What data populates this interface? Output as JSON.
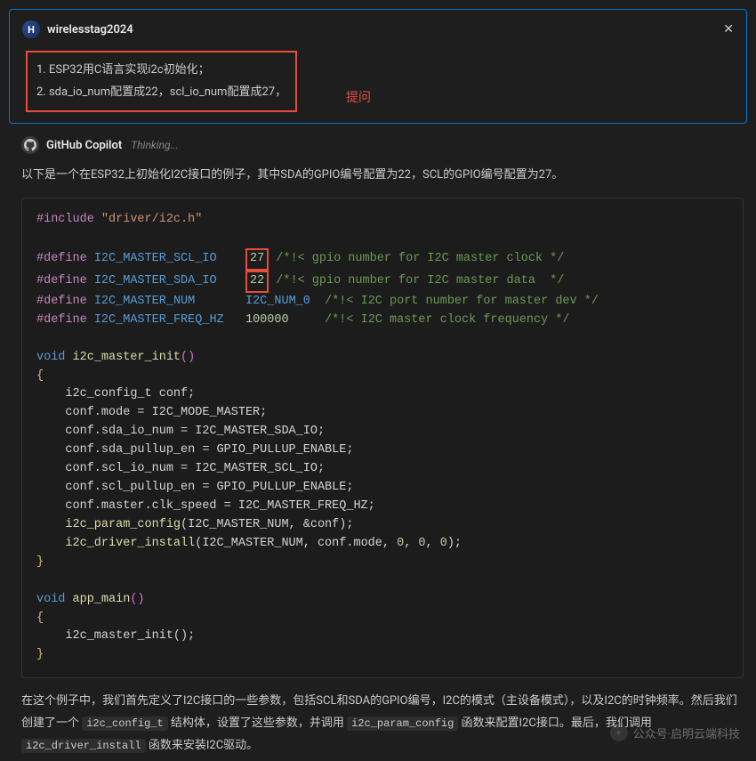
{
  "user": {
    "avatar_letter": "H",
    "name": "wirelesstag2024"
  },
  "prompt": {
    "line1": "1. ESP32用C语言实现i2c初始化；",
    "line2": "2. sda_io_num配置成22，scl_io_num配置成27，"
  },
  "annotation": "提问",
  "copilot": {
    "name": "GitHub Copilot",
    "status": "Thinking..."
  },
  "intro": "以下是一个在ESP32上初始化I2C接口的例子，其中SDA的GPIO编号配置为22，SCL的GPIO编号配置为27。",
  "code": {
    "include": "#include",
    "include_path": "\"driver/i2c.h\"",
    "define": "#define",
    "scl_macro": "I2C_MASTER_SCL_IO",
    "scl_val": "27",
    "scl_comment": "/*!< gpio number for I2C master clock */",
    "sda_macro": "I2C_MASTER_SDA_IO",
    "sda_val": "22",
    "sda_comment": "/*!< gpio number for I2C master data  */",
    "num_macro": "I2C_MASTER_NUM",
    "num_val": "I2C_NUM_0",
    "num_comment": "/*!< I2C port number for master dev */",
    "freq_macro": "I2C_MASTER_FREQ_HZ",
    "freq_val": "100000",
    "freq_comment": "/*!< I2C master clock frequency */",
    "void": "void",
    "init_fn": "i2c_master_init",
    "l1": "    i2c_config_t conf;",
    "l2": "    conf.mode = I2C_MODE_MASTER;",
    "l3": "    conf.sda_io_num = I2C_MASTER_SDA_IO;",
    "l4": "    conf.sda_pullup_en = GPIO_PULLUP_ENABLE;",
    "l5": "    conf.scl_io_num = I2C_MASTER_SCL_IO;",
    "l6": "    conf.scl_pullup_en = GPIO_PULLUP_ENABLE;",
    "l7": "    conf.master.clk_speed = I2C_MASTER_FREQ_HZ;",
    "l8a": "    i2c_param_config",
    "l8b": "(I2C_MASTER_NUM, &conf);",
    "l9a": "    i2c_driver_install",
    "l9b": "(I2C_MASTER_NUM, conf.mode, ",
    "l9c": "0",
    "l9d": ", ",
    "l9e": "0",
    "l9f": ", ",
    "l9g": "0",
    "l9h": ");",
    "main_fn": "app_main",
    "main_body": "    i2c_master_init();"
  },
  "explain": {
    "p1a": "在这个例子中，我们首先定义了I2C接口的一些参数，包括SCL和SDA的GPIO编号，I2C的模式（主设备模式），以及I2C的时钟频率。然后我们创建了一个 ",
    "c1": "i2c_config_t",
    "p1b": " 结构体，设置了这些参数，并调用 ",
    "c2": "i2c_param_config",
    "p1c": " 函数来配置I2C接口。最后，我们调用 ",
    "c3": "i2c_driver_install",
    "p1d": " 函数来安装I2C驱动。"
  },
  "watermark": "公众号·启明云端科技"
}
